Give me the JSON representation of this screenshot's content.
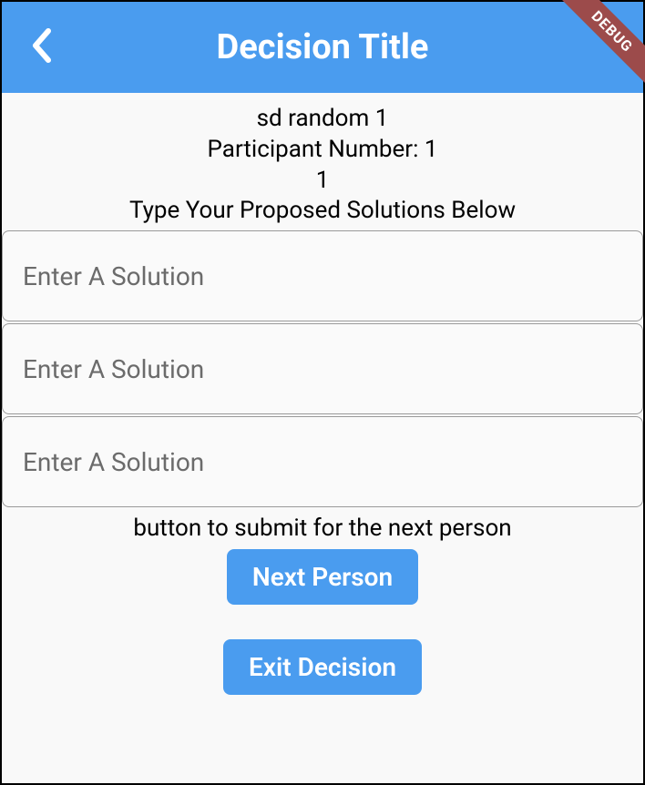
{
  "header": {
    "title": "Decision Title",
    "debug_label": "DEBUG"
  },
  "info": {
    "line1": "sd random 1",
    "line2": "Participant Number: 1",
    "line3": "1",
    "instruction": "Type Your Proposed Solutions Below"
  },
  "inputs": {
    "solution1": {
      "value": "",
      "placeholder": "Enter A Solution"
    },
    "solution2": {
      "value": "",
      "placeholder": "Enter A Solution"
    },
    "solution3": {
      "value": "",
      "placeholder": "Enter A Solution"
    }
  },
  "helper_text": "button to submit for the next person",
  "buttons": {
    "next_person": "Next Person",
    "exit_decision": "Exit Decision"
  }
}
